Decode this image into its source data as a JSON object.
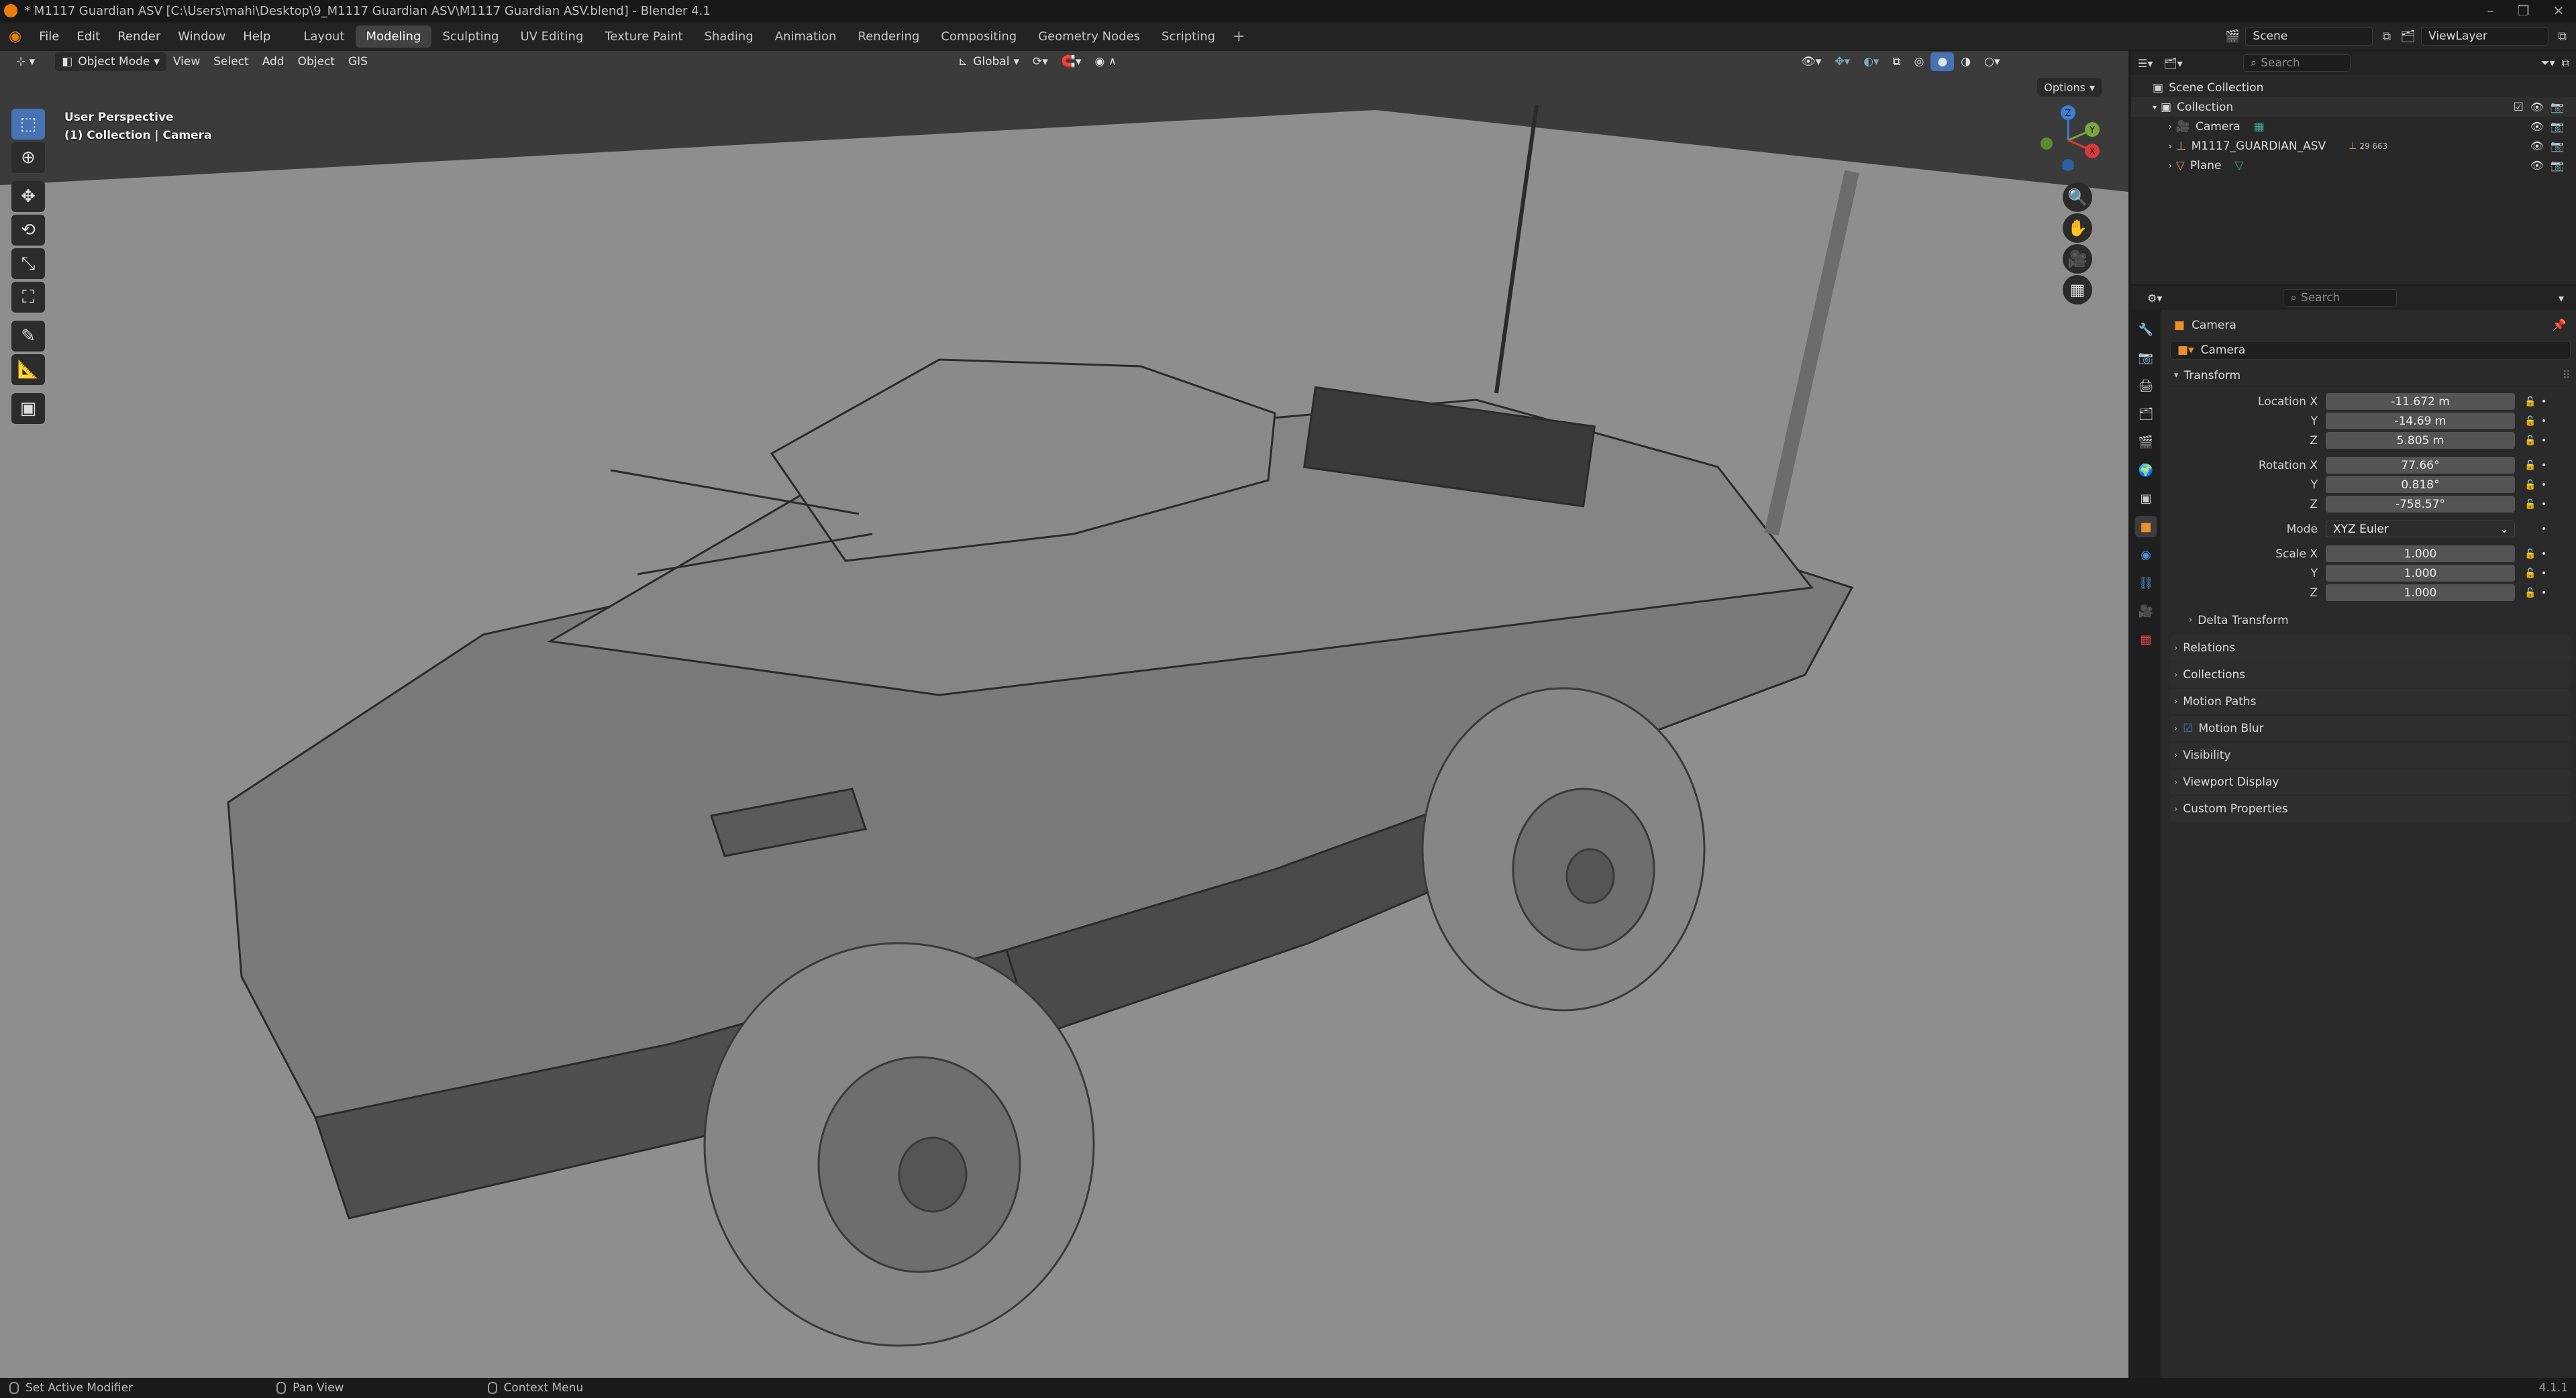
{
  "title": "* M1117 Guardian ASV [C:\\Users\\mahi\\Desktop\\9_M1117 Guardian ASV\\M1117 Guardian ASV.blend] - Blender 4.1",
  "menu": [
    "File",
    "Edit",
    "Render",
    "Window",
    "Help"
  ],
  "workspaces": [
    "Layout",
    "Modeling",
    "Sculpting",
    "UV Editing",
    "Texture Paint",
    "Shading",
    "Animation",
    "Rendering",
    "Compositing",
    "Geometry Nodes",
    "Scripting"
  ],
  "active_workspace": "Modeling",
  "scene": "Scene",
  "view_layer": "ViewLayer",
  "viewport": {
    "mode": "Object Mode",
    "menus": [
      "View",
      "Select",
      "Add",
      "Object",
      "GIS"
    ],
    "orientation": "Global",
    "options": "Options",
    "perspective": "User Perspective",
    "collection_info": "(1) Collection | Camera",
    "gizmo_axes": [
      "Z",
      "Y",
      "X"
    ]
  },
  "outliner": {
    "search_placeholder": "Search",
    "root": "Scene Collection",
    "collection": "Collection",
    "items": [
      "Camera",
      "M1117_GUARDIAN_ASV",
      "Plane"
    ],
    "vertex_group_count": "29 663"
  },
  "properties": {
    "search_placeholder": "Search",
    "object_name": "Camera",
    "object_field": "Camera",
    "transform_label": "Transform",
    "location": {
      "label": "Location X",
      "x": "-11.672 m",
      "y": "-14.69 m",
      "z": "5.805 m"
    },
    "rotation": {
      "label": "Rotation X",
      "x": "77.66°",
      "y": "0.818°",
      "z": "-758.57°"
    },
    "mode_label": "Mode",
    "mode_value": "XYZ Euler",
    "scale": {
      "label": "Scale X",
      "x": "1.000",
      "y": "1.000",
      "z": "1.000"
    },
    "axis_y": "Y",
    "axis_z": "Z",
    "delta": "Delta Transform",
    "sections": [
      "Relations",
      "Collections",
      "Motion Paths",
      "Motion Blur",
      "Visibility",
      "Viewport Display",
      "Custom Properties"
    ]
  },
  "status": {
    "left": "Set Active Modifier",
    "middle": "Pan View",
    "right": "Context Menu",
    "version": "4.1.1"
  },
  "colors": {
    "accent": "#4772b3",
    "active_workspace": "#424242",
    "blender_orange": "#e87d0d"
  }
}
